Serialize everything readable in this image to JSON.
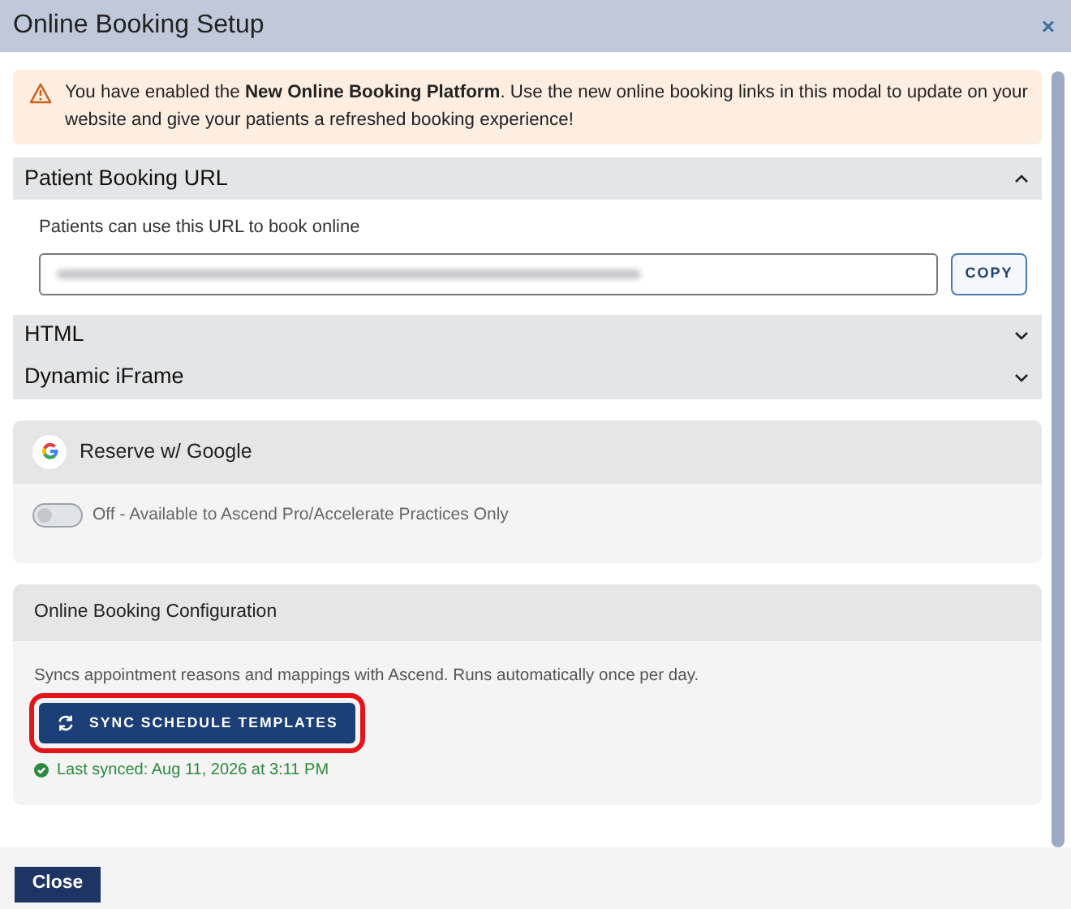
{
  "window": {
    "title": "Online Booking Setup",
    "close": "×"
  },
  "alert": {
    "text": "You have enabled the **New Online Booking Platform**. Use the new online booking links in this modal to update on your website and give your patients a refreshed booking experience!"
  },
  "accordion": [
    {
      "title": "Patient Booking URL",
      "expanded": true,
      "label": "Patients can use this URL to book online",
      "button": "COPY"
    },
    {
      "title": "HTML",
      "expanded": false
    },
    {
      "title": "Dynamic iFrame",
      "expanded": false
    }
  ],
  "google": {
    "title": "Reserve w/ Google",
    "toggle": {
      "on": false,
      "label": "Off - Available to Ascend Pro/Accelerate Practices Only"
    }
  },
  "config": {
    "title": "Online Booking Configuration",
    "description": "Syncs appointment reasons and mappings with Ascend. Runs automatically once per day.",
    "button": {
      "label": "SYNC SCHEDULE TEMPLATES",
      "highlighted": true
    },
    "status": "Last synced: Aug 11, 2026 at 3:11 PM"
  },
  "footer": {
    "button": "Close"
  }
}
